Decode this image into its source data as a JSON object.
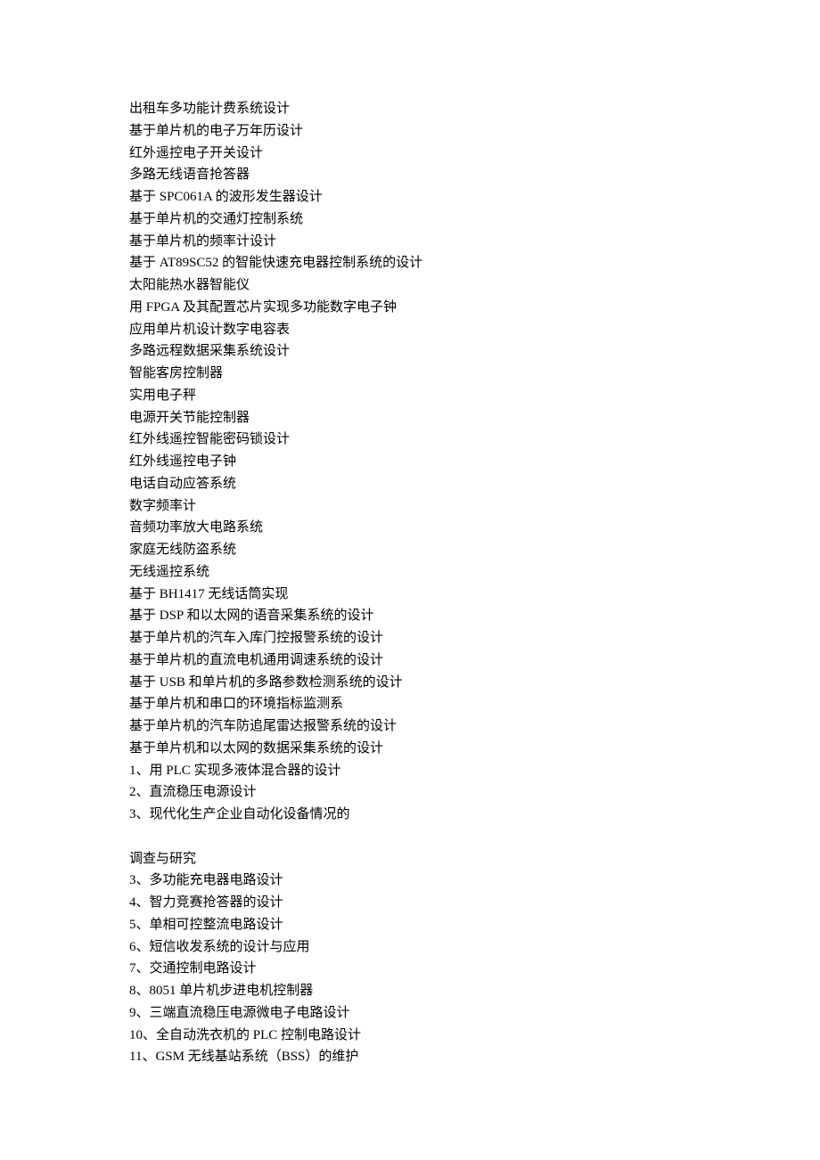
{
  "lines": [
    "出租车多功能计费系统设计",
    "基于单片机的电子万年历设计",
    "红外遥控电子开关设计",
    "多路无线语音抢答器",
    "基于 SPC061A 的波形发生器设计",
    "基于单片机的交通灯控制系统",
    "基于单片机的频率计设计",
    "基于 AT89SC52 的智能快速充电器控制系统的设计",
    "太阳能热水器智能仪",
    "用 FPGA 及其配置芯片实现多功能数字电子钟",
    "应用单片机设计数字电容表",
    "多路远程数据采集系统设计",
    "智能客房控制器",
    "实用电子秤",
    "电源开关节能控制器",
    "红外线遥控智能密码锁设计",
    "红外线遥控电子钟",
    "电话自动应答系统",
    "数字频率计",
    "音频功率放大电路系统",
    "家庭无线防盗系统",
    "无线遥控系统",
    "基于 BH1417 无线话筒实现",
    "基于 DSP 和以太网的语音采集系统的设计",
    "基于单片机的汽车入库门控报警系统的设计",
    "基于单片机的直流电机通用调速系统的设计",
    "基于 USB 和单片机的多路参数检测系统的设计",
    "基于单片机和串口的环境指标监测系",
    "基于单片机的汽车防追尾雷达报警系统的设计",
    "基于单片机和以太网的数据采集系统的设计",
    "1、用 PLC 实现多液体混合器的设计",
    "2、直流稳压电源设计",
    "3、现代化生产企业自动化设备情况的",
    "",
    "调查与研究",
    "3、多功能充电器电路设计",
    "4、智力竞赛抢答器的设计",
    "5、单相可控整流电路设计",
    "6、短信收发系统的设计与应用",
    "7、交通控制电路设计",
    "8、8051 单片机步进电机控制器",
    "9、三端直流稳压电源微电子电路设计",
    "10、全自动洗衣机的 PLC 控制电路设计",
    "11、GSM 无线基站系统（BSS）的维护"
  ]
}
